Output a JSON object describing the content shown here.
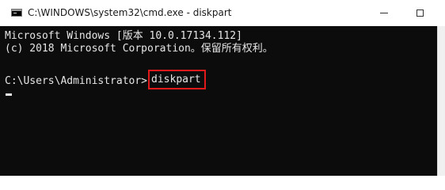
{
  "window": {
    "title": "C:\\WINDOWS\\system32\\cmd.exe - diskpart"
  },
  "title_bar": {
    "icon": "cmd-console-icon",
    "minimize_icon": "minimize-icon",
    "maximize_icon": "maximize-icon"
  },
  "console": {
    "lines": [
      "Microsoft Windows [版本 10.0.17134.112]",
      "(c) 2018 Microsoft Corporation。保留所有权利。"
    ],
    "prompt": "C:\\Users\\Administrator>",
    "command": "diskpart",
    "background_color": "#0c0c0c",
    "text_color": "#e6e6e6",
    "highlight_color": "#e01a1a"
  }
}
